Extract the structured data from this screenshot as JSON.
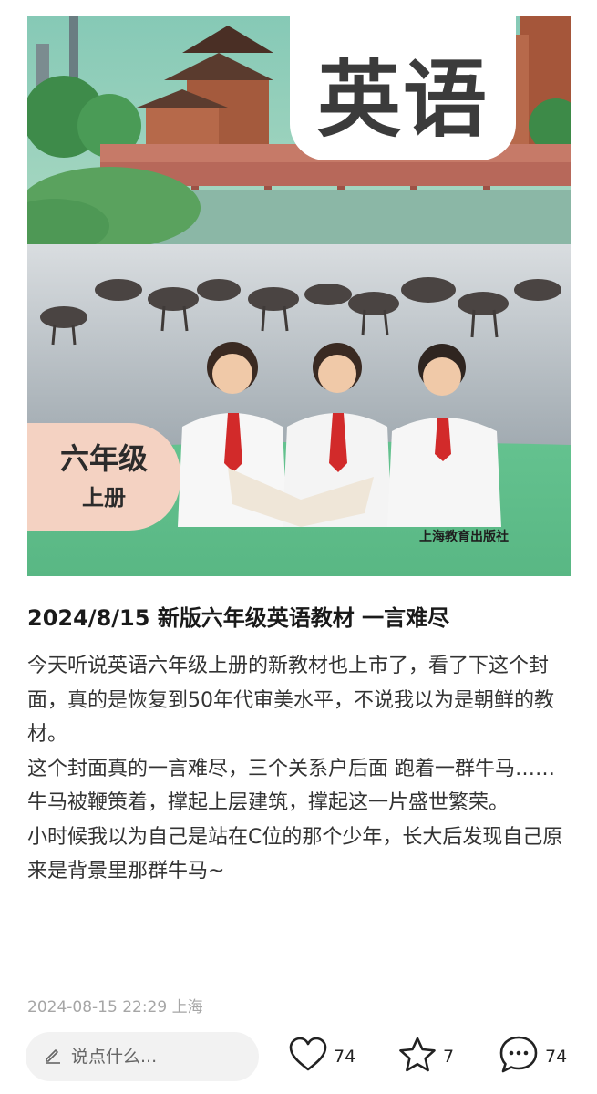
{
  "cover": {
    "title": "英语",
    "grade": "六年级",
    "volume": "上册",
    "publisher": "上海教育出版社"
  },
  "post": {
    "title": "2024/8/15 新版六年级英语教材 一言难尽",
    "paragraphs": [
      "今天听说英语六年级上册的新教材也上市了，看了下这个封面，真的是恢复到50年代审美水平，不说我以为是朝鲜的教材。",
      "这个封面真的一言难尽，三个关系户后面 跑着一群牛马……牛马被鞭策着，撑起上层建筑，撑起这一片盛世繁荣。",
      "小时候我以为自己是站在C位的那个少年，长大后发现自己原来是背景里那群牛马~"
    ],
    "meta": "2024-08-15 22:29 上海"
  },
  "actions": {
    "comment_placeholder": "说点什么...",
    "likes": "74",
    "favorites": "7",
    "comments": "74"
  },
  "icons": {
    "edit": "pencil-icon",
    "like": "heart-icon",
    "favorite": "star-icon",
    "comment": "speech-bubble-icon"
  }
}
